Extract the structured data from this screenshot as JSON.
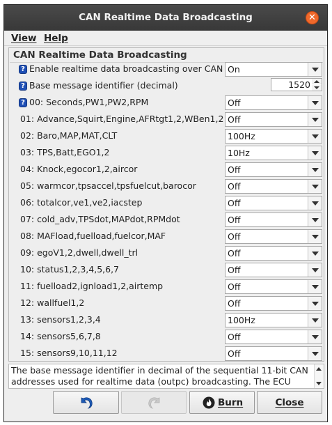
{
  "window": {
    "title": "CAN Realtime Data Broadcasting",
    "close_glyph": "✕"
  },
  "menu": [
    {
      "label": "View"
    },
    {
      "label": "Help"
    }
  ],
  "panel": {
    "title": "CAN Realtime Data Broadcasting",
    "enable_label": "Enable realtime data broadcasting over CAN",
    "enable_value": "On",
    "base_id_label": "Base message identifier (decimal)",
    "base_id_value": "1520",
    "help_glyph": "?",
    "rows": [
      {
        "label": "00: Seconds,PW1,PW2,RPM",
        "value": "Off"
      },
      {
        "label": "01: Advance,Squirt,Engine,AFRtgt1,2,WBen1,2",
        "value": "Off"
      },
      {
        "label": "02: Baro,MAP,MAT,CLT",
        "value": "100Hz"
      },
      {
        "label": "03: TPS,Batt,EGO1,2",
        "value": "10Hz"
      },
      {
        "label": "04: Knock,egocor1,2,aircor",
        "value": "Off"
      },
      {
        "label": "05: warmcor,tpsaccel,tpsfuelcut,barocor",
        "value": "Off"
      },
      {
        "label": "06: totalcor,ve1,ve2,iacstep",
        "value": "Off"
      },
      {
        "label": "07: cold_adv,TPSdot,MAPdot,RPMdot",
        "value": "Off"
      },
      {
        "label": "08: MAFload,fuelload,fuelcor,MAF",
        "value": "Off"
      },
      {
        "label": "09: egoV1,2,dwell,dwell_trl",
        "value": "Off"
      },
      {
        "label": "10: status1,2,3,4,5,6,7",
        "value": "Off"
      },
      {
        "label": "11: fuelload2,ignload1,2,airtemp",
        "value": "Off"
      },
      {
        "label": "12: wallfuel1,2",
        "value": "Off"
      },
      {
        "label": "13: sensors1,2,3,4",
        "value": "100Hz"
      },
      {
        "label": "14: sensors5,6,7,8",
        "value": "Off"
      },
      {
        "label": "15: sensors9,10,11,12",
        "value": "Off"
      }
    ]
  },
  "help_text": "The base message identifier in decimal of the sequential 11-bit CAN addresses used for realtime data (outpc) broadcasting. The ECU",
  "buttons": {
    "undo_icon": "undo-icon",
    "redo_icon": "redo-icon",
    "burn_label": "Burn",
    "close_label": "Close"
  },
  "colors": {
    "titlebar": "#3e3e3e",
    "close_accent": "#f0692b",
    "help_icon": "#1f4fb5"
  }
}
